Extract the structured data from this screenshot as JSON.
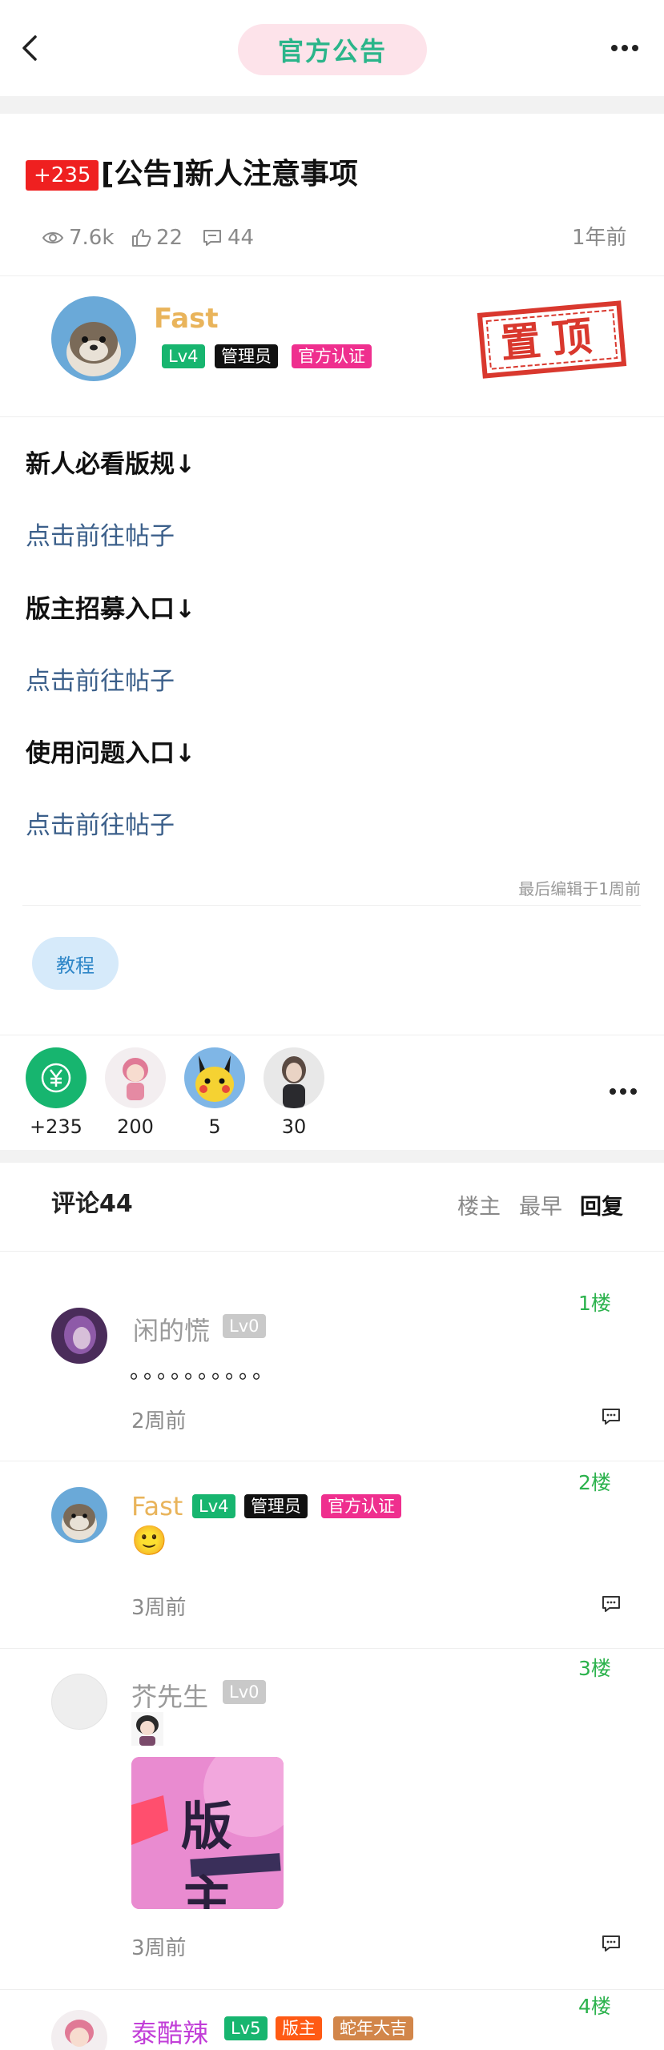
{
  "header": {
    "title": "官方公告",
    "back_icon": "back-arrow-icon",
    "more_icon": "more-dots-icon"
  },
  "post": {
    "score_badge": "+235",
    "title": "[公告]新人注意事项",
    "views": "7.6k",
    "likes": "22",
    "comments": "44",
    "time": "1年前",
    "pinned_stamp": "置顶",
    "stamp_color": "#d9382e"
  },
  "author": {
    "name": "Fast",
    "level": "Lv4",
    "role": "管理员",
    "cert": "官方认证"
  },
  "body": {
    "sections": [
      {
        "heading": "新人必看版规↓",
        "link": "点击前往帖子"
      },
      {
        "heading": "版主招募入口↓",
        "link": "点击前往帖子"
      },
      {
        "heading": "使用问题入口↓",
        "link": "点击前往帖子"
      }
    ],
    "edit_note": "最后编辑于1周前",
    "tag_chip": "教程"
  },
  "donors": {
    "items": [
      {
        "label": "+235",
        "icon": "yen-icon"
      },
      {
        "label": "200"
      },
      {
        "label": "5"
      },
      {
        "label": "30"
      }
    ],
    "more_icon": "more-dots-icon"
  },
  "comments": {
    "title": "评论44",
    "sort": [
      "楼主",
      "最早",
      "回复"
    ],
    "sort_active": "回复",
    "items": [
      {
        "floor": "1楼",
        "name": "闲的慌",
        "level": "Lv0",
        "text": "。。。。。。。。。。",
        "time": "2周前"
      },
      {
        "floor": "2楼",
        "name": "Fast",
        "level": "Lv4",
        "role": "管理员",
        "cert": "官方认证",
        "emoji": "🙂",
        "time": "3周前"
      },
      {
        "floor": "3楼",
        "name": "芥先生",
        "level": "Lv0",
        "image_text": "版主",
        "time": "3周前"
      },
      {
        "floor": "4楼",
        "name": "泰酷辣",
        "level": "Lv5",
        "role": "版主",
        "badge": "蛇年大吉"
      }
    ]
  },
  "colors": {
    "accent_green": "#2bb58a",
    "floor_green": "#2bb24c",
    "link_blue": "#3b5f8a",
    "gold_name": "#e9b45b"
  }
}
